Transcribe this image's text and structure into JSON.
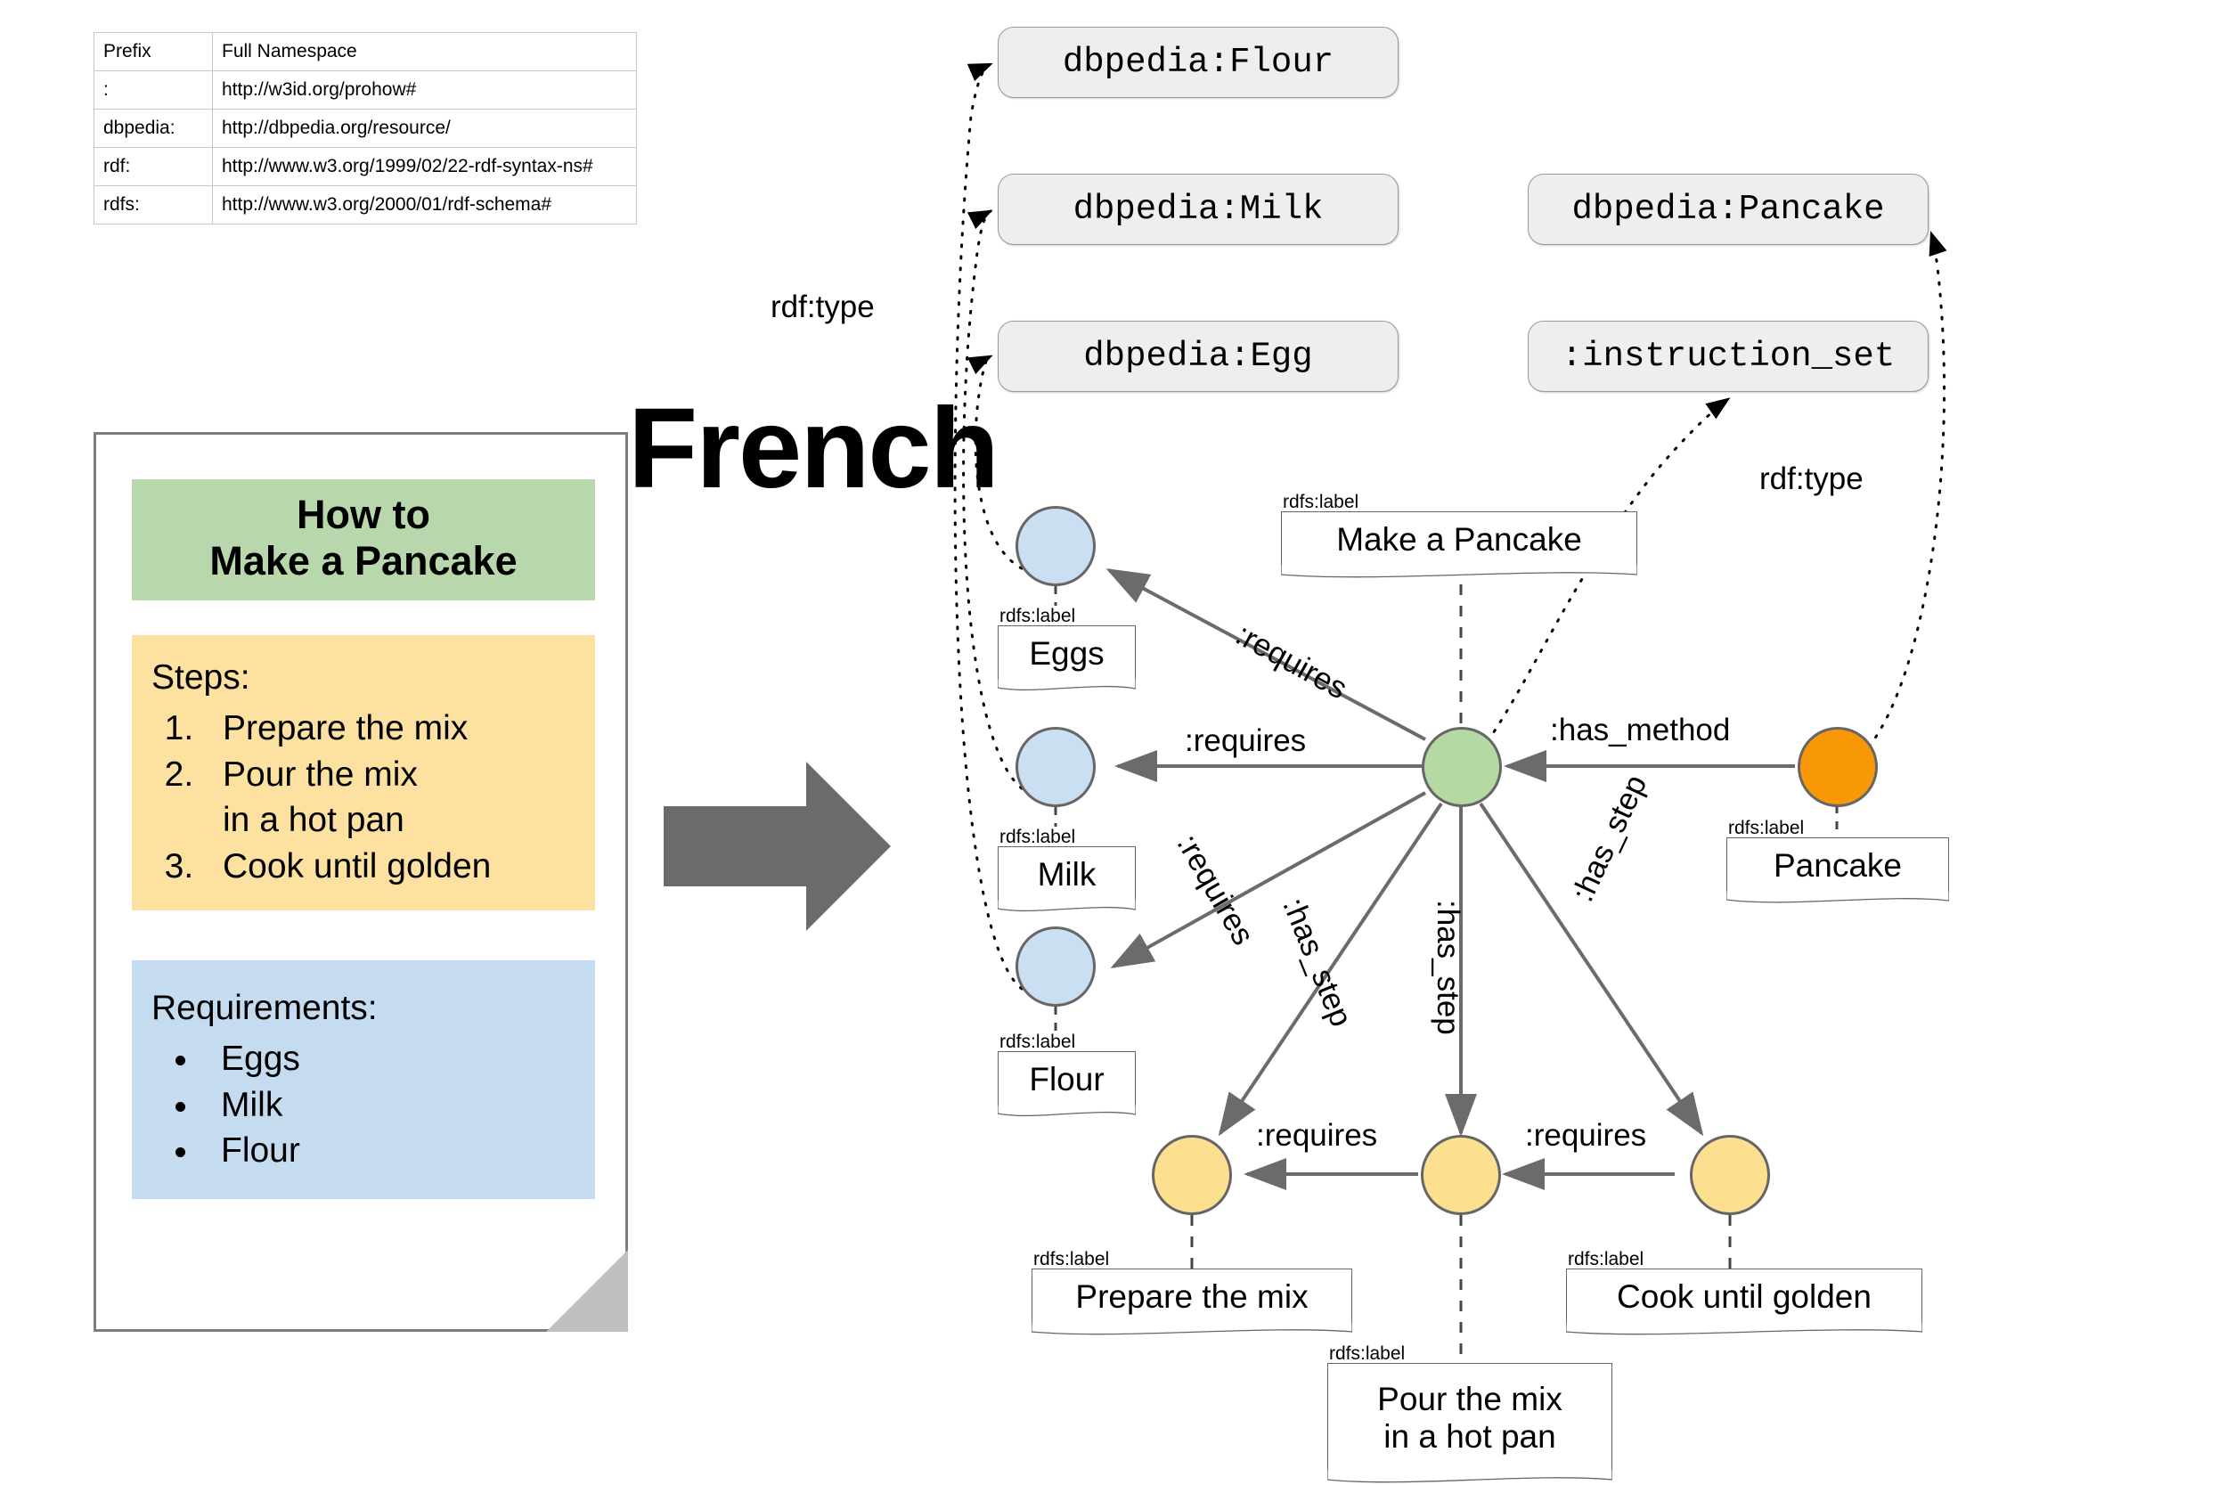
{
  "prefix_table": {
    "headers": [
      "Prefix",
      "Full Namespace"
    ],
    "rows": [
      {
        "prefix": ":",
        "namespace": "http://w3id.org/prohow#"
      },
      {
        "prefix": "dbpedia:",
        "namespace": "http://dbpedia.org/resource/"
      },
      {
        "prefix": "rdf:",
        "namespace": "http://www.w3.org/1999/02/22-rdf-syntax-ns#"
      },
      {
        "prefix": "rdfs:",
        "namespace": "http://www.w3.org/2000/01/rdf-schema#"
      }
    ]
  },
  "document_card": {
    "title_line1": "How to",
    "title_line2": "Make a Pancake",
    "steps_heading": "Steps:",
    "steps": [
      "Prepare the mix",
      "Pour the mix",
      "in a hot pan",
      "Cook until golden"
    ],
    "step_items": [
      "Prepare the mix",
      "Pour the mix\nin a hot pan",
      "Cook until golden"
    ],
    "requirements_heading": "Requirements:",
    "requirements": [
      "Eggs",
      "Milk",
      "Flour"
    ]
  },
  "headline": "French",
  "namespace_boxes": [
    {
      "id": "flour",
      "text": "dbpedia:Flour"
    },
    {
      "id": "milk",
      "text": "dbpedia:Milk"
    },
    {
      "id": "pancake",
      "text": "dbpedia:Pancake"
    },
    {
      "id": "egg",
      "text": "dbpedia:Egg"
    },
    {
      "id": "instruction_set",
      "text": ":instruction_set"
    }
  ],
  "graph": {
    "nodes": [
      {
        "id": "eggs",
        "color": "blue",
        "label": "Eggs"
      },
      {
        "id": "milk",
        "color": "blue",
        "label": "Milk"
      },
      {
        "id": "flour",
        "color": "blue",
        "label": "Flour"
      },
      {
        "id": "task",
        "color": "green",
        "label": "Make a Pancake"
      },
      {
        "id": "pancake",
        "color": "orange",
        "label": "Pancake"
      },
      {
        "id": "step1",
        "color": "yellow",
        "label": "Prepare the mix"
      },
      {
        "id": "step2",
        "color": "yellow",
        "label": "Pour the mix\nin a hot pan"
      },
      {
        "id": "step3",
        "color": "yellow",
        "label": "Cook until golden"
      }
    ],
    "label_tag": "rdfs:label",
    "edges": [
      {
        "from": "task",
        "to": "eggs",
        "label": ":requires"
      },
      {
        "from": "task",
        "to": "milk",
        "label": ":requires"
      },
      {
        "from": "task",
        "to": "flour",
        "label": ":requires"
      },
      {
        "from": "pancake",
        "to": "task",
        "label": ":has_method"
      },
      {
        "from": "task",
        "to": "step1",
        "label": ":has_step"
      },
      {
        "from": "task",
        "to": "step2",
        "label": ":has_step"
      },
      {
        "from": "task",
        "to": "step3",
        "label": ":has_step"
      },
      {
        "from": "step2",
        "to": "step1",
        "label": ":requires"
      },
      {
        "from": "step3",
        "to": "step2",
        "label": ":requires"
      }
    ],
    "type_edges": [
      {
        "from": "eggs",
        "to": "dbpedia:Egg",
        "label": "rdf:type"
      },
      {
        "from": "milk",
        "to": "dbpedia:Milk",
        "label": "rdf:type"
      },
      {
        "from": "flour",
        "to": "dbpedia:Flour",
        "label": "rdf:type"
      },
      {
        "from": "task",
        "to": ":instruction_set",
        "label": "rdf:type"
      },
      {
        "from": "pancake",
        "to": "dbpedia:Pancake",
        "label": "rdf:type"
      }
    ],
    "type_label_left": "rdf:type",
    "type_label_right": "rdf:type",
    "node_labels": {
      "eggs": "Eggs",
      "milk": "Milk",
      "flour": "Flour",
      "task": "Make a Pancake",
      "pancake": "Pancake",
      "step1": "Prepare the mix",
      "step2_line1": "Pour the mix",
      "step2_line2": "in a hot pan",
      "step3": "Cook until golden"
    },
    "edge_labels": {
      "requires_eggs": ":requires",
      "requires_milk": ":requires",
      "requires_flour": ":requires",
      "has_method": ":has_method",
      "has_step_1": ":has_step",
      "has_step_2": ":has_step",
      "has_step_3": ":has_step",
      "requires_step1": ":requires",
      "requires_step2": ":requires"
    }
  },
  "colors": {
    "blue": "#cbdff2",
    "green": "#b4d9a3",
    "yellow": "#fce08f",
    "orange": "#f99806",
    "card_title_bg": "#b9d7ac",
    "card_steps_bg": "#fce1a0",
    "card_reqs_bg": "#c5dcf0",
    "arrow_gray": "#6b6b6b",
    "box_bg": "#eeeeee"
  }
}
